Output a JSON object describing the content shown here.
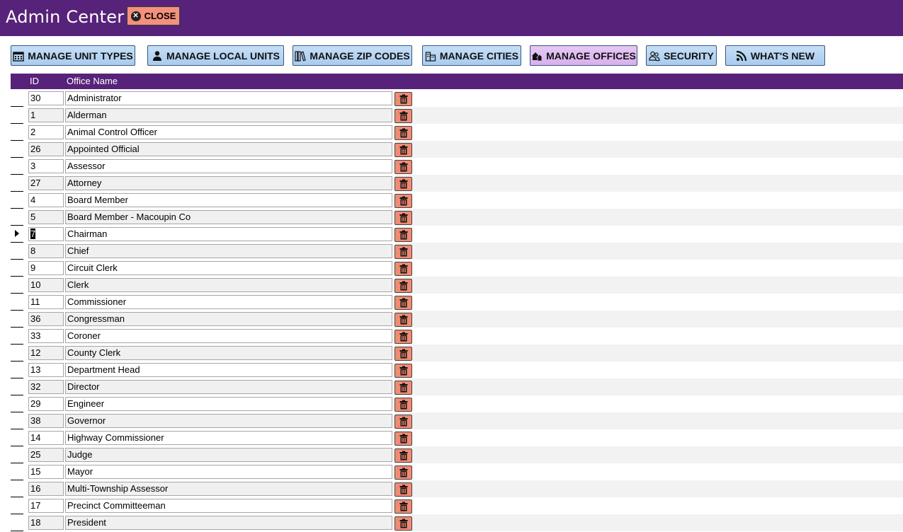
{
  "app": {
    "title": "Admin Center"
  },
  "header": {
    "close_label": "CLOSE"
  },
  "toolbar": {
    "buttons": [
      {
        "label": "MANAGE UNIT TYPES",
        "icon": "calendar-icon",
        "active": false
      },
      {
        "label": "MANAGE LOCAL UNITS",
        "icon": "user-icon",
        "active": false
      },
      {
        "label": "MANAGE ZIP CODES",
        "icon": "books-icon",
        "active": false
      },
      {
        "label": "MANAGE CITIES",
        "icon": "city-icon",
        "active": false
      },
      {
        "label": "MANAGE OFFICES",
        "icon": "houses-icon",
        "active": true
      },
      {
        "label": "SECURITY",
        "icon": "users-icon",
        "active": false
      },
      {
        "label": "WHAT'S NEW",
        "icon": "rss-icon",
        "active": false
      }
    ]
  },
  "table": {
    "columns": {
      "id": "ID",
      "name": "Office Name"
    },
    "selected_row": 8,
    "rows": [
      {
        "id": "30",
        "name": "Administrator"
      },
      {
        "id": "1",
        "name": "Alderman"
      },
      {
        "id": "2",
        "name": "Animal Control Officer"
      },
      {
        "id": "26",
        "name": "Appointed Official"
      },
      {
        "id": "3",
        "name": "Assessor"
      },
      {
        "id": "27",
        "name": "Attorney"
      },
      {
        "id": "4",
        "name": "Board Member"
      },
      {
        "id": "5",
        "name": "Board Member - Macoupin Co"
      },
      {
        "id": "7",
        "name": "Chairman"
      },
      {
        "id": "8",
        "name": "Chief"
      },
      {
        "id": "9",
        "name": "Circuit Clerk"
      },
      {
        "id": "10",
        "name": "Clerk"
      },
      {
        "id": "11",
        "name": "Commissioner"
      },
      {
        "id": "36",
        "name": "Congressman"
      },
      {
        "id": "33",
        "name": "Coroner"
      },
      {
        "id": "12",
        "name": "County Clerk"
      },
      {
        "id": "13",
        "name": "Department Head"
      },
      {
        "id": "32",
        "name": "Director"
      },
      {
        "id": "29",
        "name": "Engineer"
      },
      {
        "id": "38",
        "name": "Governor"
      },
      {
        "id": "14",
        "name": "Highway Commissioner"
      },
      {
        "id": "25",
        "name": "Judge"
      },
      {
        "id": "15",
        "name": "Mayor"
      },
      {
        "id": "16",
        "name": "Multi-Township Assessor"
      },
      {
        "id": "17",
        "name": "Precinct Committeeman"
      },
      {
        "id": "18",
        "name": "President"
      }
    ]
  },
  "colors": {
    "header_bg": "#572279",
    "button_bg": "#b3d1f0",
    "active_button_bg": "#dcbaef",
    "close_bg": "#f4917c",
    "delete_bg": "#f08b74"
  }
}
